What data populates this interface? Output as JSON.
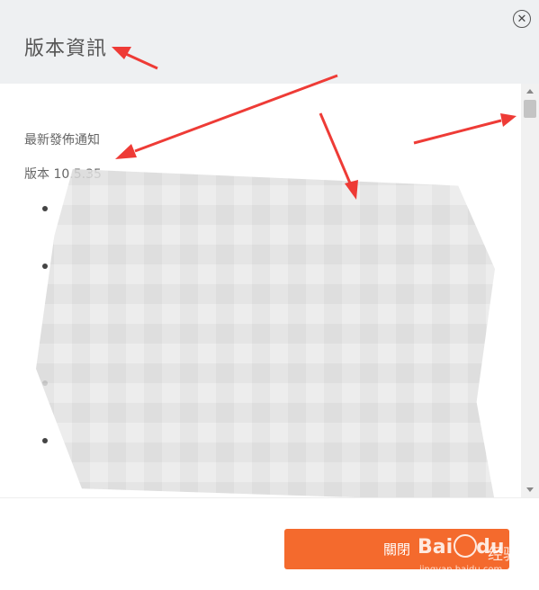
{
  "dialog": {
    "title": "版本資訊",
    "close_icon": "close-circle-icon",
    "close_glyph": "✕"
  },
  "content": {
    "section_title": "最新發佈通知",
    "version": "版本 10.5.35"
  },
  "footer": {
    "close_label": "關閉"
  },
  "watermark": {
    "brand": "Bai",
    "brand_suffix": "du",
    "sub": "经验",
    "url": "jingyan.baidu.com"
  },
  "colors": {
    "header_bg": "#eef0f2",
    "accent": "#f46a2d",
    "annotation": "#ee3b36"
  }
}
